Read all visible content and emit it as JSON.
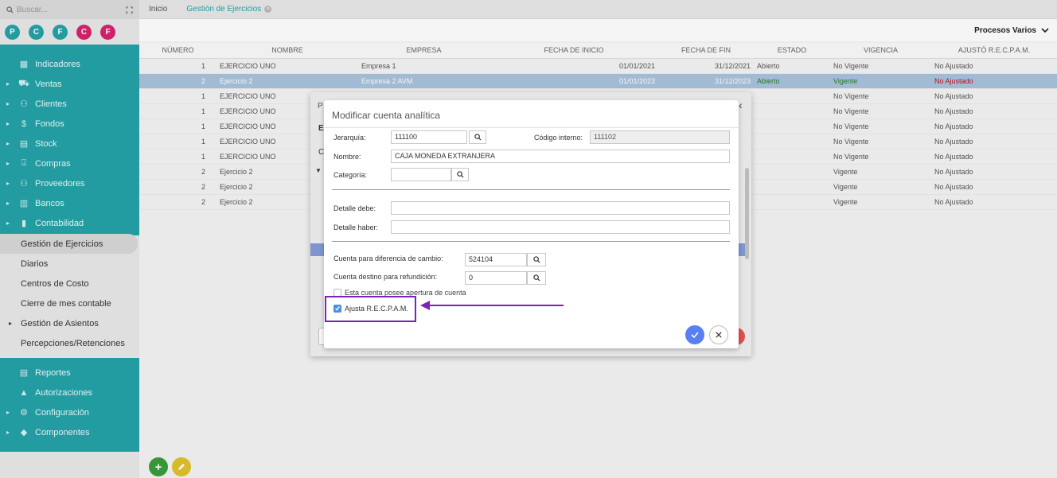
{
  "sidebar": {
    "search_placeholder": "Buscar...",
    "avatars": [
      {
        "letter": "P",
        "color": "#25a3a8"
      },
      {
        "letter": "C",
        "color": "#25a3a8"
      },
      {
        "letter": "F",
        "color": "#25a3a8"
      },
      {
        "letter": "C",
        "color": "#d6246e"
      },
      {
        "letter": "F",
        "color": "#d6246e"
      }
    ],
    "menu": [
      {
        "label": "Indicadores",
        "icon": "grid-icon",
        "caret": false
      },
      {
        "label": "Ventas",
        "icon": "cart-icon",
        "caret": true
      },
      {
        "label": "Clientes",
        "icon": "users-icon",
        "caret": true
      },
      {
        "label": "Fondos",
        "icon": "dollar-icon",
        "caret": true
      },
      {
        "label": "Stock",
        "icon": "box-icon",
        "caret": true
      },
      {
        "label": "Compras",
        "icon": "basket-icon",
        "caret": true
      },
      {
        "label": "Proveedores",
        "icon": "users-icon",
        "caret": true
      },
      {
        "label": "Bancos",
        "icon": "bank-icon",
        "caret": true
      },
      {
        "label": "Contabilidad",
        "icon": "book-icon",
        "caret": true
      }
    ],
    "submenu": [
      {
        "label": "Gestión de Ejercicios",
        "active": true
      },
      {
        "label": "Diarios"
      },
      {
        "label": "Centros de Costo"
      },
      {
        "label": "Cierre de mes contable"
      },
      {
        "label": "Gestión de Asientos",
        "caret": true
      },
      {
        "label": "Percepciones/Retenciones"
      }
    ],
    "menu2": [
      {
        "label": "Reportes",
        "icon": "report-icon",
        "caret": false
      },
      {
        "label": "Autorizaciones",
        "icon": "lock-icon",
        "caret": false
      },
      {
        "label": "Configuración",
        "icon": "gear-icon",
        "caret": true
      },
      {
        "label": "Componentes",
        "icon": "puzzle-icon",
        "caret": true
      }
    ]
  },
  "tabs": [
    {
      "label": "Inicio",
      "active": false
    },
    {
      "label": "Gestión de Ejercicios",
      "active": true
    }
  ],
  "toolbar": {
    "processes_label": "Procesos Varios"
  },
  "table": {
    "headers": [
      "NÚMERO",
      "NOMBRE",
      "EMPRESA",
      "FECHA DE INICIO",
      "FECHA DE FIN",
      "ESTADO",
      "VIGENCIA",
      "AJUSTÓ R.E.C.P.A.M."
    ],
    "rows": [
      {
        "num": "1",
        "nombre": "EJERCICIO UNO",
        "empresa": "Empresa 1",
        "inicio": "01/01/2021",
        "fin": "31/12/2021",
        "estado": "Abierto",
        "vigencia": "No Vigente",
        "ajusto": "No Ajustado",
        "selected": false
      },
      {
        "num": "2",
        "nombre": "Ejercicio 2",
        "empresa": "Empresa 2 AVM",
        "inicio": "01/01/2023",
        "fin": "31/12/2023",
        "estado": "Abierto",
        "vigencia": "Vigente",
        "ajusto": "No Ajustado",
        "selected": true
      },
      {
        "num": "1",
        "nombre": "EJERCICIO UNO",
        "empresa": "",
        "inicio": "",
        "fin": "",
        "estado": "",
        "vigencia": "No Vigente",
        "ajusto": "No Ajustado",
        "selected": false
      },
      {
        "num": "1",
        "nombre": "EJERCICIO UNO",
        "empresa": "",
        "inicio": "",
        "fin": "",
        "estado": "",
        "vigencia": "No Vigente",
        "ajusto": "No Ajustado",
        "selected": false
      },
      {
        "num": "1",
        "nombre": "EJERCICIO UNO",
        "empresa": "",
        "inicio": "",
        "fin": "",
        "estado": "",
        "vigencia": "No Vigente",
        "ajusto": "No Ajustado",
        "selected": false
      },
      {
        "num": "1",
        "nombre": "EJERCICIO UNO",
        "empresa": "",
        "inicio": "",
        "fin": "",
        "estado": "",
        "vigencia": "No Vigente",
        "ajusto": "No Ajustado",
        "selected": false
      },
      {
        "num": "1",
        "nombre": "EJERCICIO UNO",
        "empresa": "",
        "inicio": "",
        "fin": "",
        "estado": "",
        "vigencia": "No Vigente",
        "ajusto": "No Ajustado",
        "selected": false
      },
      {
        "num": "2",
        "nombre": "Ejercicio 2",
        "empresa": "",
        "inicio": "",
        "fin": "",
        "estado": "",
        "vigencia": "Vigente",
        "ajusto": "No Ajustado",
        "selected": false
      },
      {
        "num": "2",
        "nombre": "Ejercicio 2",
        "empresa": "",
        "inicio": "",
        "fin": "",
        "estado": "",
        "vigencia": "Vigente",
        "ajusto": "No Ajustado",
        "selected": false
      },
      {
        "num": "2",
        "nombre": "Ejercicio 2",
        "empresa": "",
        "inicio": "",
        "fin": "",
        "estado": "",
        "vigencia": "Vigente",
        "ajusto": "No Ajustado",
        "selected": false
      }
    ]
  },
  "back_dialog": {
    "partial_labels": [
      "P",
      "E",
      "C"
    ]
  },
  "modal": {
    "title": "Modificar cuenta analítica",
    "jerarquia_label": "Jerarquía:",
    "jerarquia_value": "111100",
    "codigo_label": "Código interno:",
    "codigo_value": "111102",
    "nombre_label": "Nombre:",
    "nombre_value": "CAJA MONEDA EXTRANJERA",
    "categoria_label": "Categoría:",
    "categoria_value": "",
    "debe_label": "Detalle debe:",
    "debe_value": "",
    "haber_label": "Detalle haber:",
    "haber_value": "",
    "dif_cambio_label": "Cuenta para diferencia de cambio:",
    "dif_cambio_value": "524104",
    "refundicion_label": "Cuenta destino para refundición:",
    "refundicion_value": "0",
    "apertura_label": "Esta cuenta posee apertura de cuenta",
    "apertura_checked": false,
    "recpam_label": "Ajusta R.E.C.P.A.M.",
    "recpam_checked": true
  },
  "colors": {
    "teal": "#25a3a8",
    "annotation": "#7a23b8",
    "ok": "#5a7ff0",
    "selected_row": "#a9c3de"
  }
}
